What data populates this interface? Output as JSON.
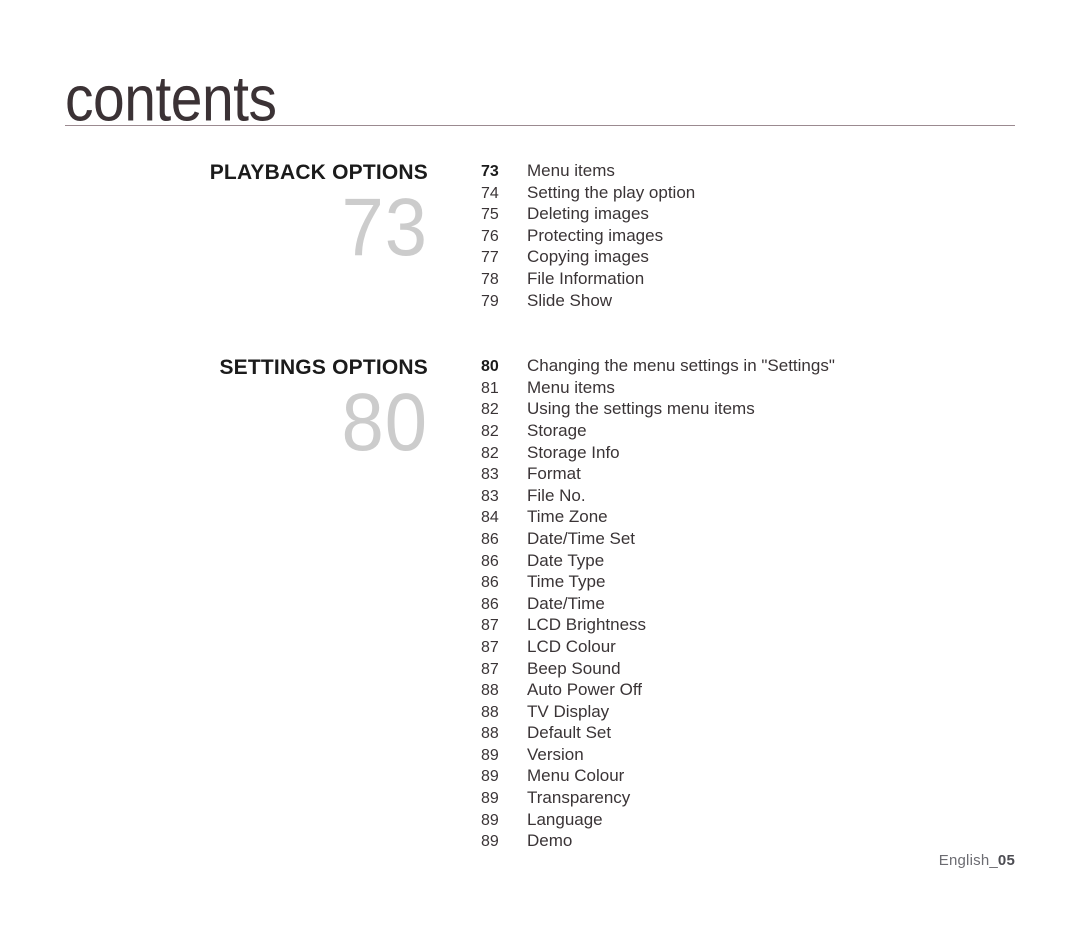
{
  "header": {
    "title": "contents"
  },
  "sections": [
    {
      "heading": "PLAYBACK OPTIONS",
      "big_number": "73",
      "entries": [
        {
          "page": "73",
          "label": "Menu items"
        },
        {
          "page": "74",
          "label": "Setting the play option"
        },
        {
          "page": "75",
          "label": "Deleting images"
        },
        {
          "page": "76",
          "label": "Protecting images"
        },
        {
          "page": "77",
          "label": "Copying images"
        },
        {
          "page": "78",
          "label": "File Information"
        },
        {
          "page": "79",
          "label": "Slide Show"
        }
      ]
    },
    {
      "heading": "SETTINGS OPTIONS",
      "big_number": "80",
      "entries": [
        {
          "page": "80",
          "label": "Changing the menu settings in \"Settings\""
        },
        {
          "page": "81",
          "label": "Menu items"
        },
        {
          "page": "82",
          "label": "Using the settings menu items"
        },
        {
          "page": "82",
          "label": "Storage"
        },
        {
          "page": "82",
          "label": "Storage Info"
        },
        {
          "page": "83",
          "label": "Format"
        },
        {
          "page": "83",
          "label": "File No."
        },
        {
          "page": "84",
          "label": "Time Zone"
        },
        {
          "page": "86",
          "label": "Date/Time Set"
        },
        {
          "page": "86",
          "label": "Date Type"
        },
        {
          "page": "86",
          "label": "Time Type"
        },
        {
          "page": "86",
          "label": "Date/Time"
        },
        {
          "page": "87",
          "label": "LCD Brightness"
        },
        {
          "page": "87",
          "label": "LCD Colour"
        },
        {
          "page": "87",
          "label": "Beep Sound"
        },
        {
          "page": "88",
          "label": "Auto Power Off"
        },
        {
          "page": "88",
          "label": "TV Display"
        },
        {
          "page": "88",
          "label": "Default Set"
        },
        {
          "page": "89",
          "label": "Version"
        },
        {
          "page": "89",
          "label": "Menu Colour"
        },
        {
          "page": "89",
          "label": "Transparency"
        },
        {
          "page": "89",
          "label": "Language"
        },
        {
          "page": "89",
          "label": "Demo"
        }
      ]
    }
  ],
  "footer": {
    "language": "English_",
    "page_number": "05"
  },
  "colors": {
    "title_text": "#3b3235",
    "rule": "#9b8a90",
    "heading_text": "#1b1b1b",
    "big_number": "#cccccc",
    "entry_text": "#3a3436",
    "footer_text": "#6c6c72",
    "background": "#ffffff"
  }
}
